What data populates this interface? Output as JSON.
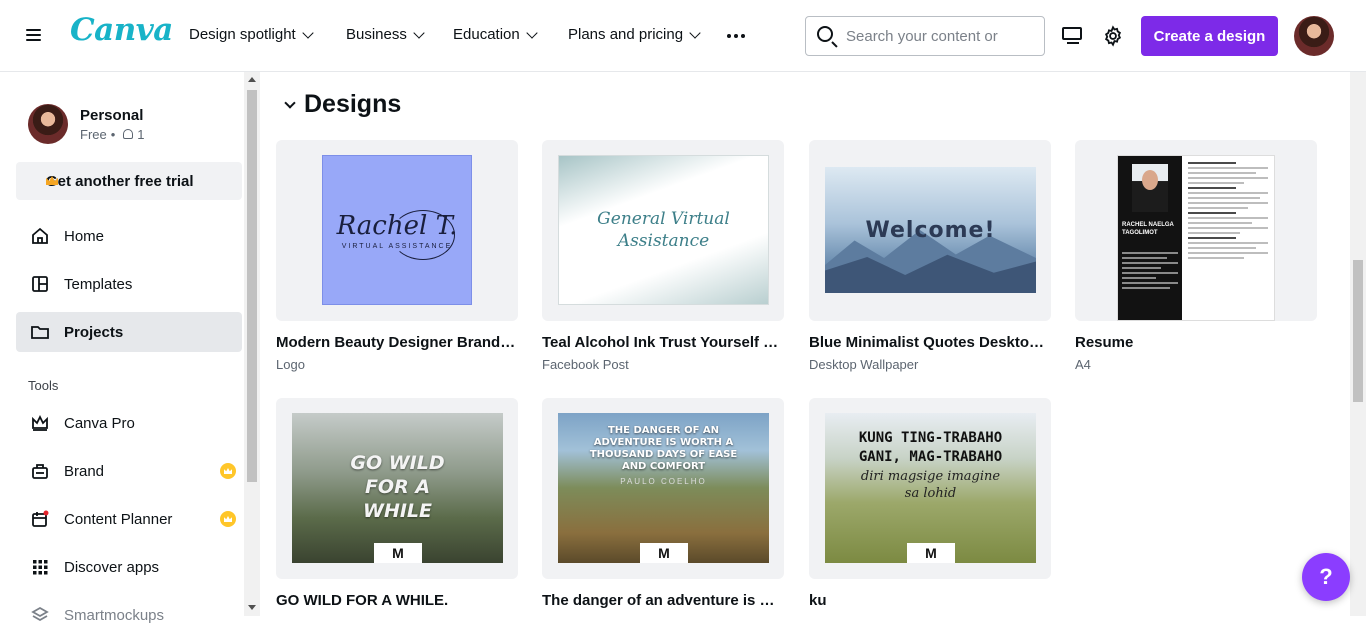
{
  "header": {
    "logo": "Canva",
    "nav": [
      {
        "label": "Design spotlight"
      },
      {
        "label": "Business"
      },
      {
        "label": "Education"
      },
      {
        "label": "Plans and pricing"
      }
    ],
    "search_placeholder": "Search your content or",
    "create_label": "Create a design"
  },
  "sidebar": {
    "account_name": "Personal",
    "account_plan": "Free",
    "account_members": "1",
    "trial_label": "Get another free trial",
    "items": [
      {
        "label": "Home"
      },
      {
        "label": "Templates"
      },
      {
        "label": "Projects"
      }
    ],
    "tools_label": "Tools",
    "tools": [
      {
        "label": "Canva Pro"
      },
      {
        "label": "Brand"
      },
      {
        "label": "Content Planner"
      },
      {
        "label": "Discover apps"
      },
      {
        "label": "Smartmockups"
      }
    ]
  },
  "main": {
    "section_title": "Designs",
    "designs": [
      {
        "title": "Modern Beauty Designer Brand N...",
        "type": "Logo",
        "thumb_text": "Rachel T.",
        "thumb_sub": "VIRTUAL ASSISTANCE"
      },
      {
        "title": "Teal Alcohol Ink Trust Yourself Qu...",
        "type": "Facebook Post",
        "thumb_text": "General Virtual Assistance"
      },
      {
        "title": "Blue Minimalist Quotes  Desktop ...",
        "type": "Desktop Wallpaper",
        "thumb_text": "Welcome!"
      },
      {
        "title": "Resume",
        "type": "A4",
        "thumb_text": "RACHEL NAELGA TAGOLIMOT"
      },
      {
        "title": "GO WILD FOR A WHILE.",
        "type": "",
        "thumb_text": "GO WILD FOR A WHILE"
      },
      {
        "title": "The danger of an adventure is wor...",
        "type": "",
        "thumb_text": "THE DANGER OF AN ADVENTURE IS WORTH A THOUSAND DAYS OF EASE AND COMFORT",
        "thumb_sub": "PAULO COELHO"
      },
      {
        "title": "ku",
        "type": "",
        "thumb_text": "KUNG TING-TRABAHO GANI, MAG-TRABAHO",
        "thumb_sub": "diri magsige imagine sa lohid"
      }
    ]
  },
  "colors": {
    "brand": "#18b3c8",
    "accent": "#7d2ae8",
    "help": "#8b3dff",
    "pro_badge": "#ffc629"
  }
}
